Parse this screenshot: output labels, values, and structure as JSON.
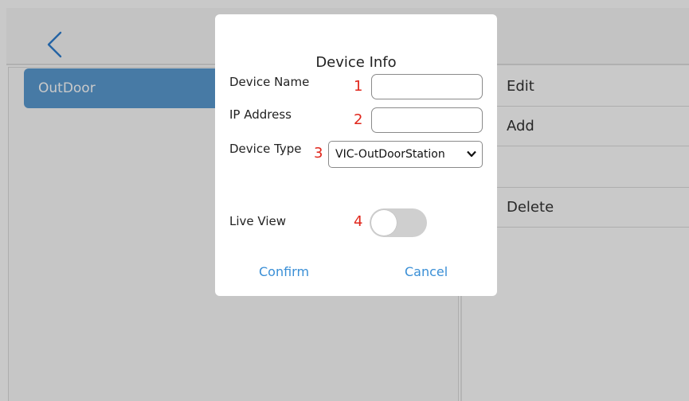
{
  "background": {
    "device_list": [
      "OutDoor"
    ],
    "actions": [
      {
        "label": "Edit",
        "icon": "edit-icon"
      },
      {
        "label": "Add",
        "icon": "add-icon"
      },
      {
        "label": "",
        "icon": ""
      },
      {
        "label": "Delete",
        "icon": "delete-icon"
      }
    ]
  },
  "dialog": {
    "title": "Device Info",
    "device_name": {
      "label": "Device Name",
      "number": "1",
      "value": "",
      "placeholder": ""
    },
    "ip_address": {
      "label": "IP Address",
      "number": "2",
      "value": "",
      "placeholder": ""
    },
    "device_type": {
      "label": "Device Type",
      "number": "3",
      "selected": "VIC-OutDoorStation"
    },
    "live_view": {
      "label": "Live View",
      "number": "4",
      "enabled": false
    },
    "confirm_label": "Confirm",
    "cancel_label": "Cancel"
  },
  "colors": {
    "accent": "#3a8fd6",
    "selected_item": "#5b9bd2",
    "annotation": "#e0261b"
  }
}
